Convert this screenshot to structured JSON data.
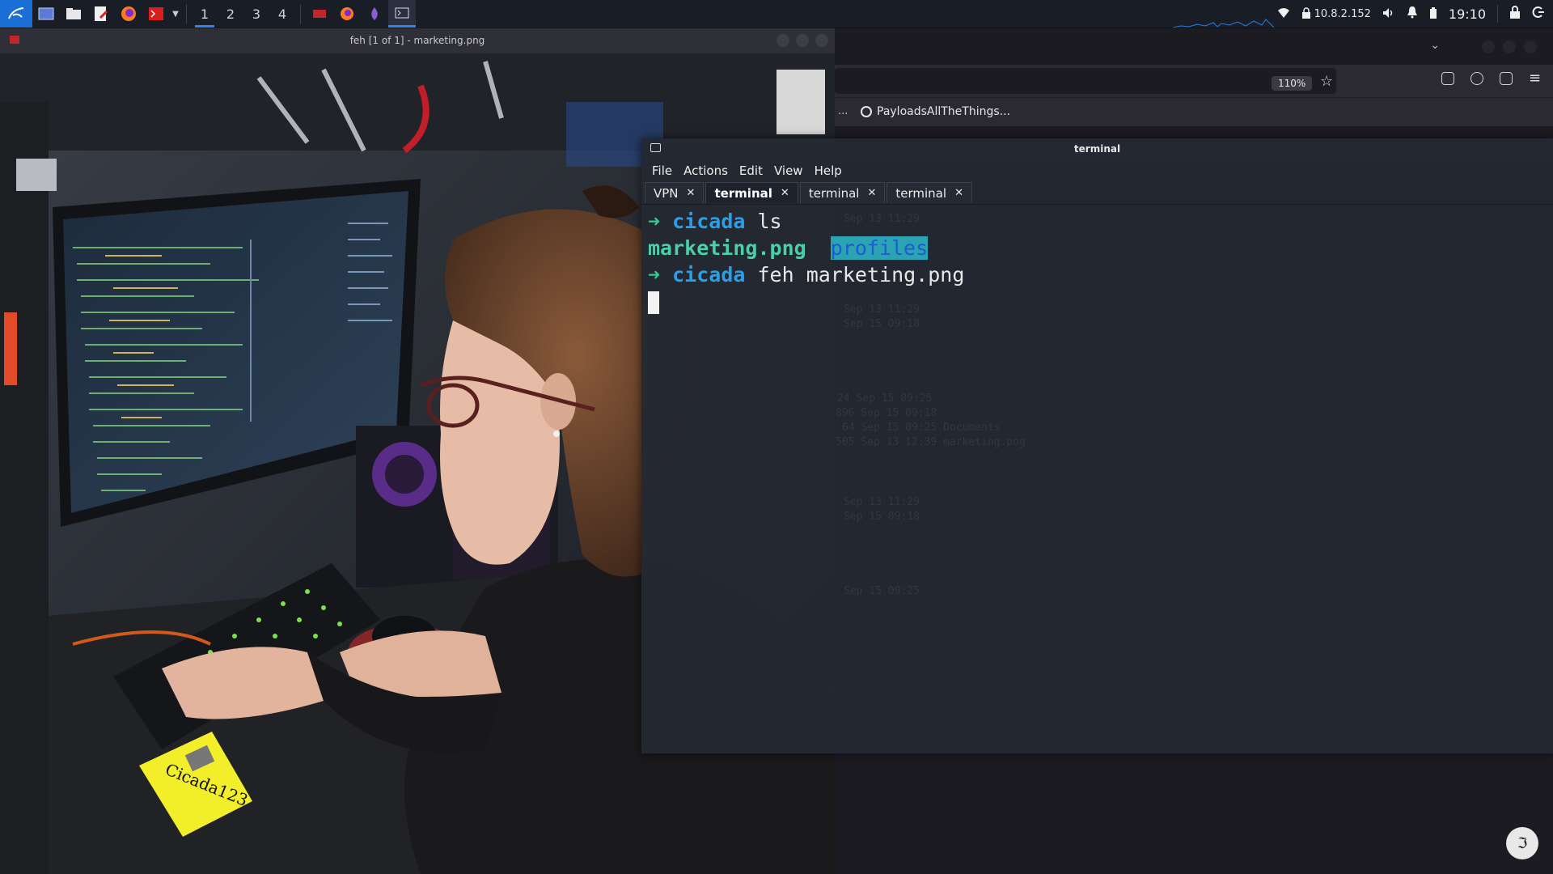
{
  "panel": {
    "workspaces": [
      "1",
      "2",
      "3",
      "4"
    ],
    "active_workspace": "1",
    "ip_address": "10.8.2.152",
    "clock": "19:10"
  },
  "feh": {
    "title": "feh [1 of 1] - marketing.png",
    "sticky_note": "Cicada123"
  },
  "browser": {
    "zoom": "110%",
    "bookmark_overflow": "...",
    "bookmark": "PayloadsAllTheThings..."
  },
  "terminal": {
    "title": "terminal",
    "menu": [
      "File",
      "Actions",
      "Edit",
      "View",
      "Help"
    ],
    "tabs": [
      {
        "label": "VPN",
        "active": false
      },
      {
        "label": "terminal",
        "active": true
      },
      {
        "label": "terminal",
        "active": false
      },
      {
        "label": "terminal",
        "active": false
      }
    ],
    "lines": {
      "l1_prompt": "➜",
      "l1_host": "cicada",
      "l1_cmd": "ls",
      "l2_file": "marketing.png",
      "l2_dir": "profiles",
      "l3_prompt": "➜",
      "l3_host": "cicada",
      "l3_cmd": "feh marketing.png"
    },
    "ghost_lines": [
      "Sep 13 11:29",
      "Sep 13 11:29",
      "Sep 15 09:18",
      "24 Sep 15 09:25",
      "896 Sep 15 09:18",
      "64 Sep 15 09:25 Documents",
      "505 Sep 13 12:39 marketing.png",
      "Sep 13 11:29",
      "Sep 15 09:18",
      "Sep 15 09:25"
    ]
  },
  "colors": {
    "accent": "#2f86e8",
    "prompt_arrow": "#38c98f",
    "prompt_host": "#2b9fe6",
    "image_file": "#4ad0a8",
    "directory_bg": "#2aa3b3"
  }
}
